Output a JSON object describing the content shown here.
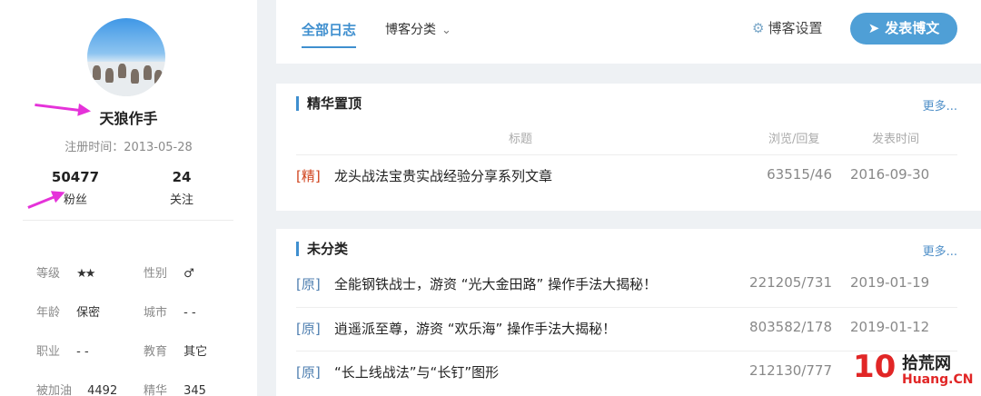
{
  "profile": {
    "username": "天狼作手",
    "register_date": "注册时间：2013-05-28",
    "fans_count": "50477",
    "fans_label": "粉丝",
    "follow_count": "24",
    "follow_label": "关注",
    "info": {
      "level_label": "等级",
      "level_stars": "★★",
      "gender_label": "性别",
      "gender_value": "♂",
      "age_label": "年龄",
      "age_value": "保密",
      "city_label": "城市",
      "city_value": "- -",
      "job_label": "职业",
      "job_value": "- -",
      "edu_label": "教育",
      "edu_value": "其它",
      "boost_label": "被加油",
      "boost_value": "4492",
      "elite_label": "精华",
      "elite_value": "345"
    }
  },
  "nav": {
    "tab_all": "全部日志",
    "tab_category": "博客分类",
    "settings_label": "博客设置",
    "publish_label": "发表博文"
  },
  "featured": {
    "title": "精华置顶",
    "more": "更多...",
    "col_title": "标题",
    "col_views": "浏览/回复",
    "col_date": "发表时间",
    "rows": [
      {
        "tag": "[精]",
        "title": "龙头战法宝贵实战经验分享系列文章",
        "views": "63515/46",
        "date": "2016-09-30"
      }
    ]
  },
  "uncategorized": {
    "title": "未分类",
    "more": "更多...",
    "rows": [
      {
        "tag": "[原]",
        "title": "全能钢铁战士，游资 “光大金田路” 操作手法大揭秘！",
        "views": "221205/731",
        "date": "2019-01-19"
      },
      {
        "tag": "[原]",
        "title": "逍遥派至尊，游资 “欢乐海” 操作手法大揭秘！",
        "views": "803582/178",
        "date": "2019-01-12"
      },
      {
        "tag": "[原]",
        "title": "“长上线战法”与“长钉”图形",
        "views": "212130/777",
        "date": ""
      }
    ]
  },
  "watermark": {
    "number": "10",
    "line1": "拾荒网",
    "line2": "Huang.CN"
  },
  "colors": {
    "accent": "#3f8fcf",
    "publish_bg": "#4f9fd6",
    "elite_tag": "#d0441e",
    "arrow": "#e532d9"
  }
}
